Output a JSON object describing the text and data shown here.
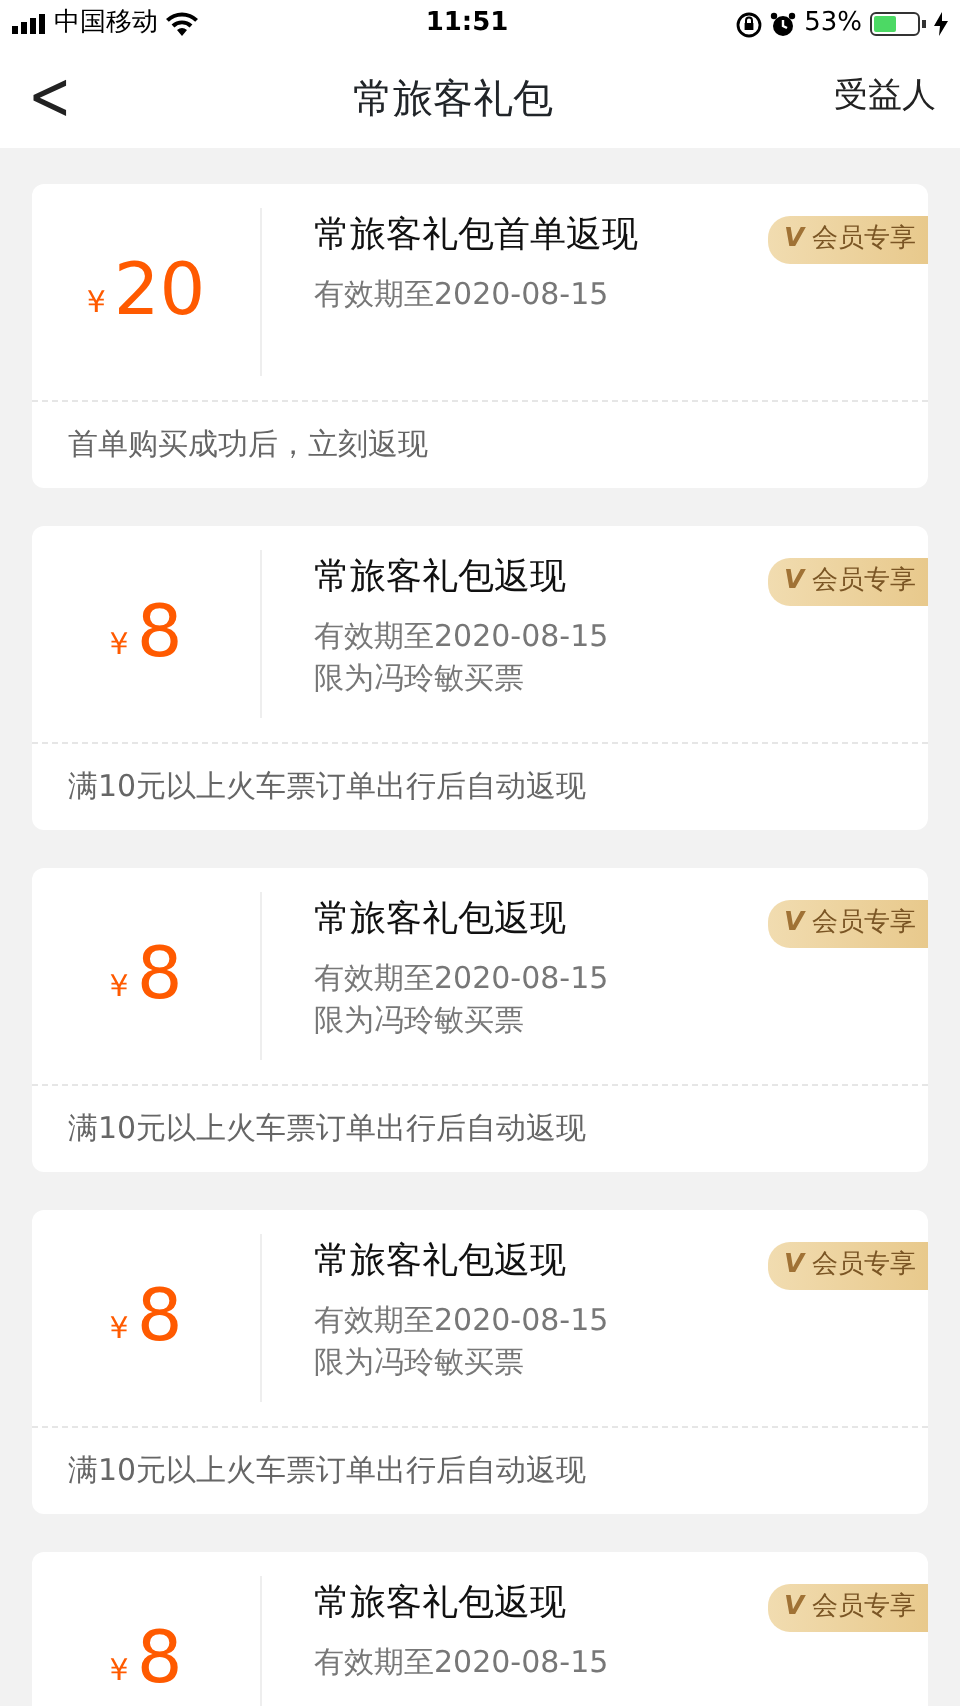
{
  "status_bar": {
    "carrier": "中国移动",
    "time": "11:51",
    "battery_text": "53%",
    "charging": true
  },
  "nav": {
    "back": "<",
    "title": "常旅客礼包",
    "action": "受益人"
  },
  "coupons": [
    {
      "currency": "¥",
      "amount": "20",
      "title": "常旅客礼包首单返现",
      "badge": "会员专享",
      "badge_mark": "V",
      "validity": "有效期至2020-08-15",
      "condition": "首单购买成功后，立刻返现"
    },
    {
      "currency": "¥",
      "amount": "8",
      "title": "常旅客礼包返现",
      "badge": "会员专享",
      "badge_mark": "V",
      "validity": "有效期至2020-08-15",
      "restriction": "限为冯玲敏买票",
      "condition": "满10元以上火车票订单出行后自动返现"
    },
    {
      "currency": "¥",
      "amount": "8",
      "title": "常旅客礼包返现",
      "badge": "会员专享",
      "badge_mark": "V",
      "validity": "有效期至2020-08-15",
      "restriction": "限为冯玲敏买票",
      "condition": "满10元以上火车票订单出行后自动返现"
    },
    {
      "currency": "¥",
      "amount": "8",
      "title": "常旅客礼包返现",
      "badge": "会员专享",
      "badge_mark": "V",
      "validity": "有效期至2020-08-15",
      "restriction": "限为冯玲敏买票",
      "condition": "满10元以上火车票订单出行后自动返现"
    },
    {
      "currency": "¥",
      "amount": "8",
      "title": "常旅客礼包返现",
      "badge": "会员专享",
      "badge_mark": "V",
      "validity": "有效期至2020-08-15"
    }
  ]
}
